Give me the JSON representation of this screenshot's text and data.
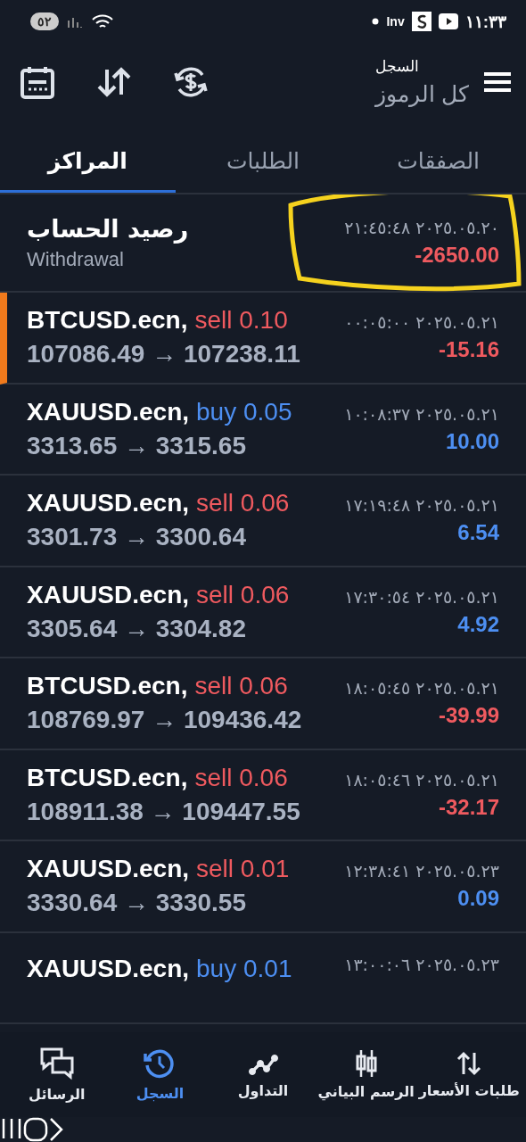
{
  "status_bar": {
    "time": "١١:٣٣",
    "notification_text": "Inv",
    "battery": "٥٢"
  },
  "header": {
    "title": "السجل",
    "subtitle": "كل الرموز"
  },
  "tabs": [
    {
      "label": "الصفقات",
      "selected": false
    },
    {
      "label": "الطلبات",
      "selected": false
    },
    {
      "label": "المراكز",
      "selected": true
    }
  ],
  "balance_entry": {
    "title": "رصيد الحساب",
    "type": "Withdrawal",
    "time": "٢٠٢٥.٠٥.٢٠ ٢١:٤٥:٤٨",
    "amount": "-2650.00",
    "color": "#ef5a5f"
  },
  "deals": [
    {
      "symbol": "BTCUSD.ecn,",
      "kind": "sell",
      "order": "sell 0.10",
      "prices": "107086.49 → 107238.11",
      "time": "٢٠٢٥.٠٥.٢١ ٠٠:٠٥:٠٠",
      "profit": "-15.16",
      "color": "#ef5a5f",
      "selected": true
    },
    {
      "symbol": "XAUUSD.ecn,",
      "kind": "buy",
      "order": "buy 0.05",
      "prices": "3313.65 → 3315.65",
      "time": "٢٠٢٥.٠٥.٢١ ١٠:٠٨:٣٧",
      "profit": "10.00",
      "color": "#4d8ff2",
      "selected": false
    },
    {
      "symbol": "XAUUSD.ecn,",
      "kind": "sell",
      "order": "sell 0.06",
      "prices": "3301.73 → 3300.64",
      "time": "٢٠٢٥.٠٥.٢١ ١٧:١٩:٤٨",
      "profit": "6.54",
      "color": "#4d8ff2",
      "selected": false
    },
    {
      "symbol": "XAUUSD.ecn,",
      "kind": "sell",
      "order": "sell 0.06",
      "prices": "3305.64 → 3304.82",
      "time": "٢٠٢٥.٠٥.٢١ ١٧:٣٠:٥٤",
      "profit": "4.92",
      "color": "#4d8ff2",
      "selected": false
    },
    {
      "symbol": "BTCUSD.ecn,",
      "kind": "sell",
      "order": "sell 0.06",
      "prices": "108769.97 → 109436.42",
      "time": "٢٠٢٥.٠٥.٢١ ١٨:٠٥:٤٥",
      "profit": "-39.99",
      "color": "#ef5a5f",
      "selected": false
    },
    {
      "symbol": "BTCUSD.ecn,",
      "kind": "sell",
      "order": "sell 0.06",
      "prices": "108911.38 → 109447.55",
      "time": "٢٠٢٥.٠٥.٢١ ١٨:٠٥:٤٦",
      "profit": "-32.17",
      "color": "#ef5a5f",
      "selected": false
    },
    {
      "symbol": "XAUUSD.ecn,",
      "kind": "sell",
      "order": "sell 0.01",
      "prices": "3330.64 → 3330.55",
      "time": "٢٠٢٥.٠٥.٢٣ ١٢:٣٨:٤١",
      "profit": "0.09",
      "color": "#4d8ff2",
      "selected": false
    },
    {
      "symbol": "XAUUSD.ecn,",
      "kind": "buy",
      "order": "buy 0.01",
      "time": "٢٠٢٥.٠٥.٢٣ ١٣:٠٠:٠٦",
      "selected": false
    }
  ],
  "bottom_nav": [
    {
      "label": "طلبات الأسعار",
      "selected": false
    },
    {
      "label": "الرسم البياني",
      "selected": false
    },
    {
      "label": "التداول",
      "selected": false
    },
    {
      "label": "السجل",
      "selected": true
    },
    {
      "label": "الرسائل",
      "selected": false
    }
  ]
}
